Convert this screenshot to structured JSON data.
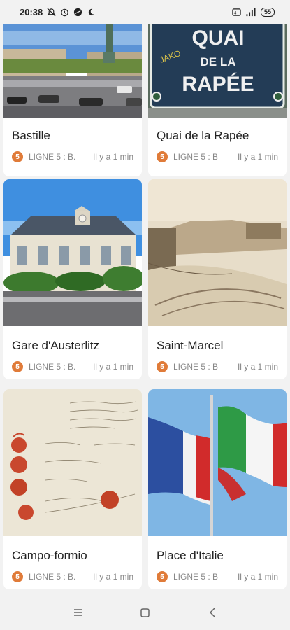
{
  "status": {
    "time": "20:38",
    "battery": "55"
  },
  "cards": [
    {
      "title": "Bastille",
      "line": "LIGNE 5 : B...",
      "badge": "5",
      "time": "Il y a 1 min",
      "image": "bastille-column"
    },
    {
      "title": "Quai de la Rapée",
      "line": "LIGNE 5 : B...",
      "badge": "5",
      "time": "Il y a 1 min",
      "image": "street-sign"
    },
    {
      "title": "Gare d'Austerlitz",
      "line": "LIGNE 5 : B...",
      "badge": "5",
      "time": "Il y a 1 min",
      "image": "train-station-facade"
    },
    {
      "title": "Saint-Marcel",
      "line": "LIGNE 5 : B...",
      "badge": "5",
      "time": "Il y a 1 min",
      "image": "old-engraving"
    },
    {
      "title": "Campo-formio",
      "line": "LIGNE 5 : B...",
      "badge": "5",
      "time": "Il y a 1 min",
      "image": "treaty-document"
    },
    {
      "title": "Place d'Italie",
      "line": "LIGNE 5 : B...",
      "badge": "5",
      "time": "Il y a 1 min",
      "image": "french-italian-flags"
    }
  ],
  "sign": {
    "line1": "QUAI",
    "line2": "DE LA",
    "line3": "RAPÉE",
    "graffiti": "JAKO"
  },
  "colors": {
    "badge": "#e07b39",
    "background": "#f2f2f2"
  }
}
